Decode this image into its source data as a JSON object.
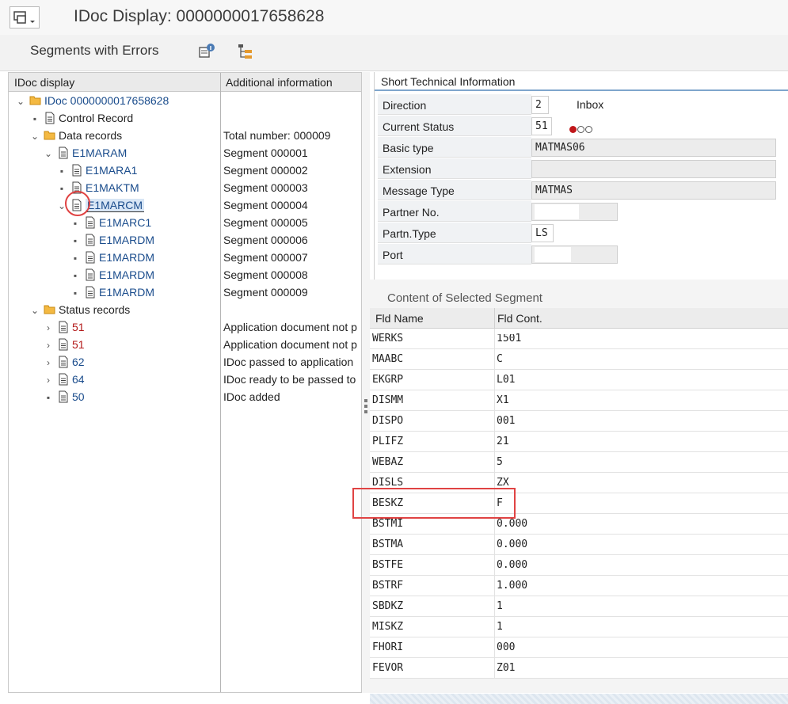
{
  "window": {
    "title": "IDoc Display: 0000000017658628"
  },
  "toolbar": {
    "segments_with_errors": "Segments with Errors",
    "icons": [
      "technical-info-icon",
      "hierarchy-icon"
    ]
  },
  "tree": {
    "header_col1": "IDoc display",
    "header_col2": "Additional information",
    "root": "IDoc 0000000017658628",
    "control_record": "Control Record",
    "data_records": "Data records",
    "e1maram": "E1MARAM",
    "e1mara1": "E1MARA1",
    "e1maktm": "E1MAKTM",
    "e1marcm": "E1MARCM",
    "e1marc1": "E1MARC1",
    "e1mardm": "E1MARDM",
    "status_records": "Status records",
    "status_items": [
      "51",
      "51",
      "62",
      "64",
      "50"
    ],
    "info": {
      "total": "Total number: 000009",
      "seg": [
        "Segment 000001",
        "Segment 000002",
        "Segment 000003",
        "Segment 000004",
        "Segment 000005",
        "Segment 000006",
        "Segment 000007",
        "Segment 000008",
        "Segment 000009"
      ],
      "status": [
        "Application document not p",
        "Application document not p",
        "IDoc passed to application",
        "IDoc ready to be passed to",
        "IDoc added"
      ]
    }
  },
  "sti": {
    "title": "Short Technical Information",
    "direction_label": "Direction",
    "direction_value": "2",
    "direction_text": "Inbox",
    "status_label": "Current Status",
    "status_value": "51",
    "basic_type_label": "Basic type",
    "basic_type_value": "MATMAS06",
    "extension_label": "Extension",
    "extension_value": "",
    "message_type_label": "Message Type",
    "message_type_value": "MATMAS",
    "partner_no_label": "Partner No.",
    "partner_no_value": "",
    "partn_type_label": "Partn.Type",
    "partn_type_value": "LS",
    "port_label": "Port",
    "port_value": ""
  },
  "segment": {
    "title": "Content of Selected Segment",
    "col_name": "Fld Name",
    "col_cont": "Fld Cont.",
    "rows": [
      {
        "name": "WERKS",
        "value": "1501"
      },
      {
        "name": "MAABC",
        "value": "C"
      },
      {
        "name": "EKGRP",
        "value": "L01"
      },
      {
        "name": "DISMM",
        "value": "X1"
      },
      {
        "name": "DISPO",
        "value": "001"
      },
      {
        "name": "PLIFZ",
        "value": "21"
      },
      {
        "name": "WEBAZ",
        "value": "5"
      },
      {
        "name": "DISLS",
        "value": "ZX"
      },
      {
        "name": "BESKZ",
        "value": "F"
      },
      {
        "name": "BSTMI",
        "value": "0.000"
      },
      {
        "name": "BSTMA",
        "value": "0.000"
      },
      {
        "name": "BSTFE",
        "value": "0.000"
      },
      {
        "name": "BSTRF",
        "value": "1.000"
      },
      {
        "name": "SBDKZ",
        "value": "1"
      },
      {
        "name": "MISKZ",
        "value": "1"
      },
      {
        "name": "FHORI",
        "value": "000"
      },
      {
        "name": "FEVOR",
        "value": "Z01"
      }
    ]
  }
}
